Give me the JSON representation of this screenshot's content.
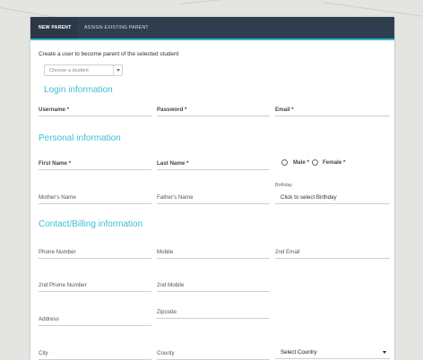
{
  "tabs": [
    {
      "label": "NEW PARENT",
      "active": true
    },
    {
      "label": "ASSIGN EXISTING PARENT",
      "active": false
    }
  ],
  "intro_text": "Create a user to become parent of the selected student",
  "student_select": {
    "placeholder": "Choose a student"
  },
  "sections": {
    "login": "Login information",
    "personal": "Personal information",
    "contact": "Contact/Billing information"
  },
  "login_fields": {
    "username": "Username *",
    "password": "Password *",
    "email": "Email *"
  },
  "personal_fields": {
    "first_name": "First Name *",
    "last_name": "Last Name *",
    "male": "Male *",
    "female": "Female *",
    "mothers_name": "Mother's Name",
    "fathers_name": "Father's Name",
    "birthday_label": "Birthday",
    "birthday_value": "Click to select Birthday"
  },
  "contact_fields": {
    "phone": "Phone Number",
    "mobile": "Mobile",
    "email2": "2nd Email",
    "phone2": "2nd Phone Number",
    "mobile2": "2nd Mobile",
    "address": "Address",
    "zipcode": "Zipcode",
    "city": "City",
    "county": "County",
    "country": "Select Country"
  },
  "colors": {
    "tabbar": "#2f3e4e",
    "accent": "#3dbed6"
  }
}
